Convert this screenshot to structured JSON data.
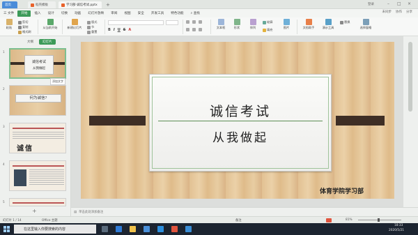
{
  "titlebar": {
    "home_tab": "首页",
    "doc_tab": "稻壳模板",
    "current_tab": "学习部-诚信考试.pptx",
    "new_tab": "+",
    "user": "登录"
  },
  "menubar": {
    "items": [
      "三 文件",
      "开始",
      "插入",
      "设计",
      "切换",
      "动画",
      "幻灯片放映",
      "审阅",
      "视图",
      "安全",
      "开发工具",
      "特色功能"
    ],
    "active_index": 1,
    "search": "查找",
    "right_items": [
      "未同步",
      "协作",
      "分享"
    ]
  },
  "ribbon": {
    "paste": "粘贴",
    "cut": "剪切",
    "copy": "复制",
    "format_painter": "格式刷",
    "from_current": "从当前开始",
    "new_slide": "新建幻灯片",
    "layout": "版式",
    "section": "节",
    "reset": "重置",
    "text_box": "文本框",
    "shape": "形状",
    "arrange": "排列",
    "outline": "轮廓",
    "picture": "图片",
    "fill": "填充",
    "beautify": "文档助手",
    "show_tools": "演示工具",
    "replace": "替换",
    "select_pane": "选择窗格"
  },
  "left_panel": {
    "tab_outline": "大纲",
    "tab_slides": "幻灯片",
    "tooltip": "添加文字",
    "slides": [
      {
        "num": "1",
        "title": "诚信考试",
        "sub": "从我做起"
      },
      {
        "num": "2",
        "title": "何为诚信?"
      },
      {
        "num": "3",
        "title": "诚信"
      },
      {
        "num": "4",
        "title": ""
      },
      {
        "num": "5",
        "title": ""
      }
    ],
    "add": "+"
  },
  "slide": {
    "title": "诚信考试",
    "subtitle": "从我做起",
    "department": "体育学院学习部"
  },
  "notes": {
    "placeholder": "单击此处添加备注"
  },
  "statusbar": {
    "slide_count": "幻灯片 1 / 14",
    "theme": "Office 主题",
    "notes_label": "备注",
    "zoom": "81%"
  },
  "taskbar": {
    "search_placeholder": "在这里输入你要搜索的内容",
    "time": "18:33",
    "date": "2020/5/21"
  },
  "colors": {
    "accent_green": "#3c9a58",
    "bar_dark": "#3e2e25"
  }
}
